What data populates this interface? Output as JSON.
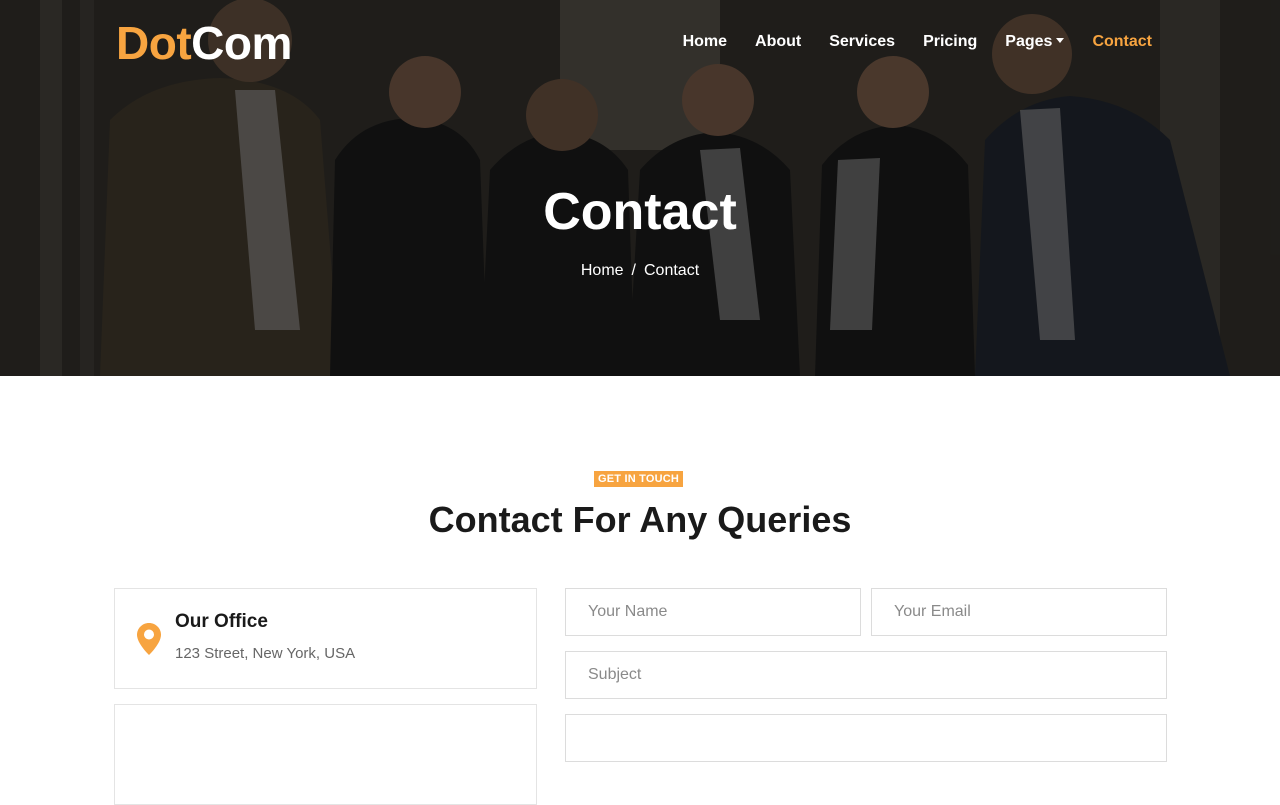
{
  "brand": {
    "part1": "Dot",
    "part2": "Com"
  },
  "nav": {
    "home": "Home",
    "about": "About",
    "services": "Services",
    "pricing": "Pricing",
    "pages": "Pages",
    "contact": "Contact"
  },
  "hero": {
    "title": "Contact",
    "breadcrumb": {
      "home": "Home",
      "separator": "/",
      "current": "Contact"
    }
  },
  "section": {
    "tag": "GET IN TOUCH",
    "title": "Contact For Any Queries"
  },
  "office": {
    "title": "Our Office",
    "address": "123 Street, New York, USA"
  },
  "form": {
    "name_placeholder": "Your Name",
    "email_placeholder": "Your Email",
    "subject_placeholder": "Subject"
  },
  "colors": {
    "accent": "#f7a440",
    "dark": "#1a1a1a"
  }
}
